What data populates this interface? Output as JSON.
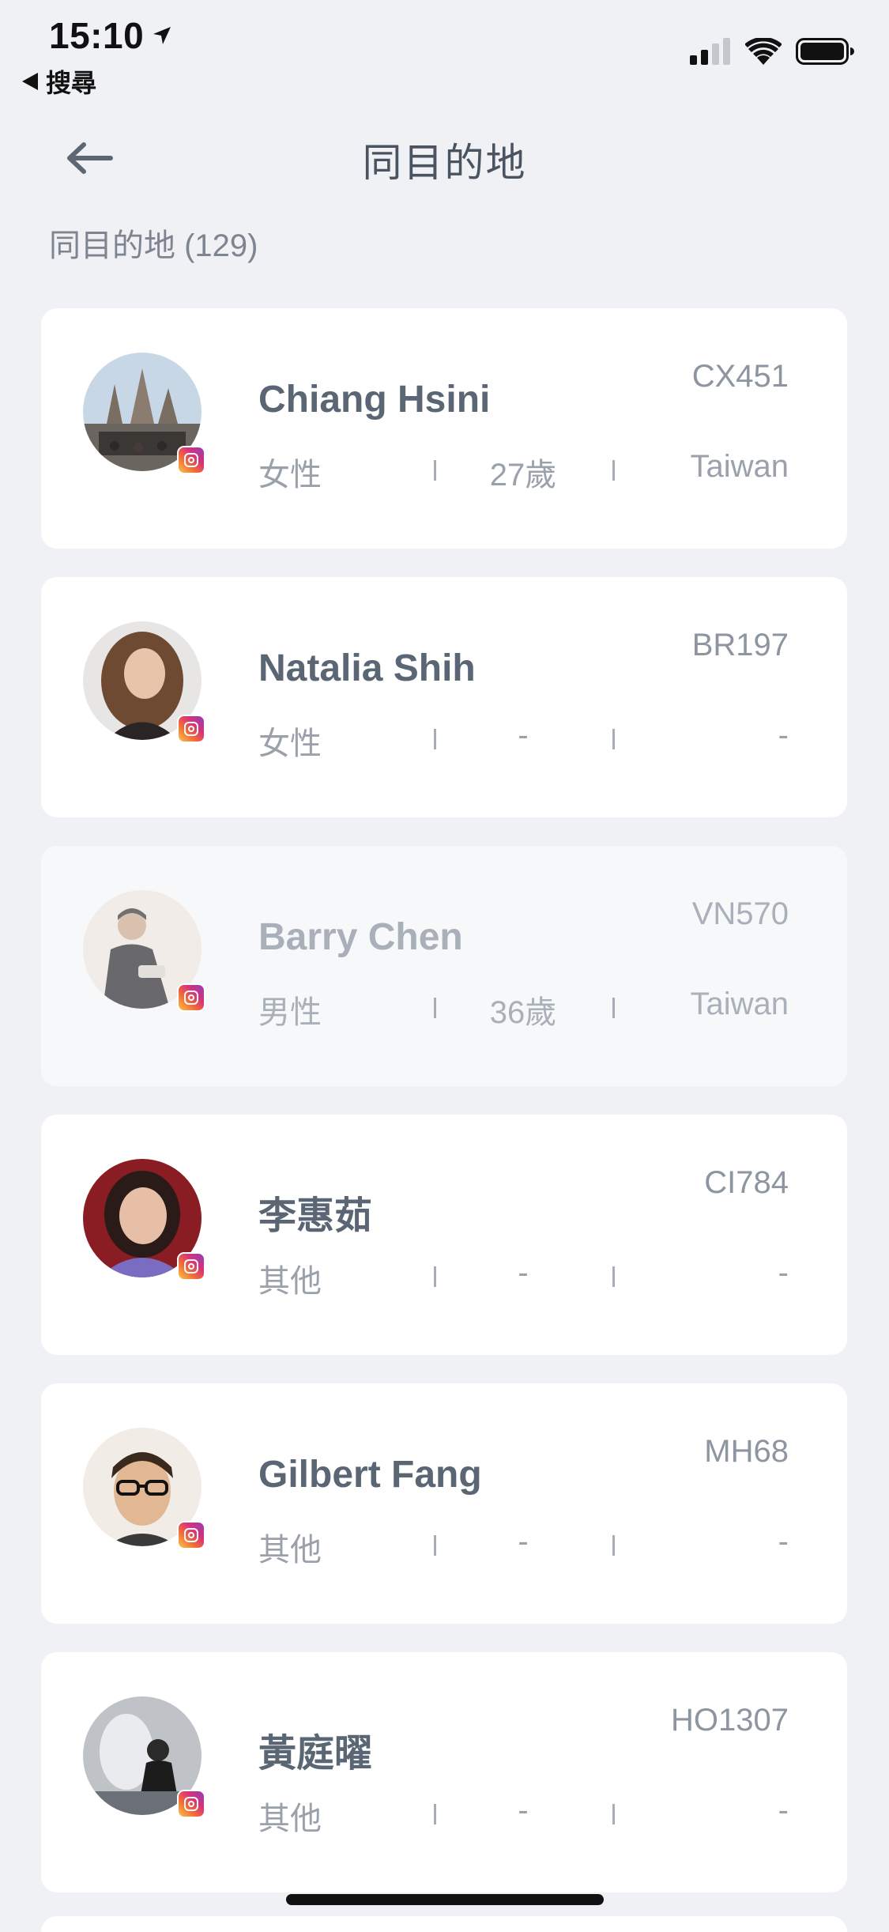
{
  "status_bar": {
    "time": "15:10",
    "back_label": "搜尋"
  },
  "header": {
    "title": "同目的地"
  },
  "section": {
    "title": "同目的地 (129)"
  },
  "colors": {
    "background": "#eff1f5",
    "card": "#ffffff",
    "text_primary": "#5b6675",
    "text_secondary": "#9aa1aa"
  },
  "travelers": [
    {
      "name": "Chiang Hsini",
      "flight": "CX451",
      "gender": "女性",
      "age": "27歲",
      "country": "Taiwan"
    },
    {
      "name": "Natalia Shih",
      "flight": "BR197",
      "gender": "女性",
      "age": "-",
      "country": "-"
    },
    {
      "name": "Barry Chen",
      "flight": "VN570",
      "gender": "男性",
      "age": "36歲",
      "country": "Taiwan"
    },
    {
      "name": "李惠茹",
      "flight": "CI784",
      "gender": "其他",
      "age": "-",
      "country": "-"
    },
    {
      "name": "Gilbert Fang",
      "flight": "MH68",
      "gender": "其他",
      "age": "-",
      "country": "-"
    },
    {
      "name": "黃庭曜",
      "flight": "HO1307",
      "gender": "其他",
      "age": "-",
      "country": "-"
    }
  ]
}
